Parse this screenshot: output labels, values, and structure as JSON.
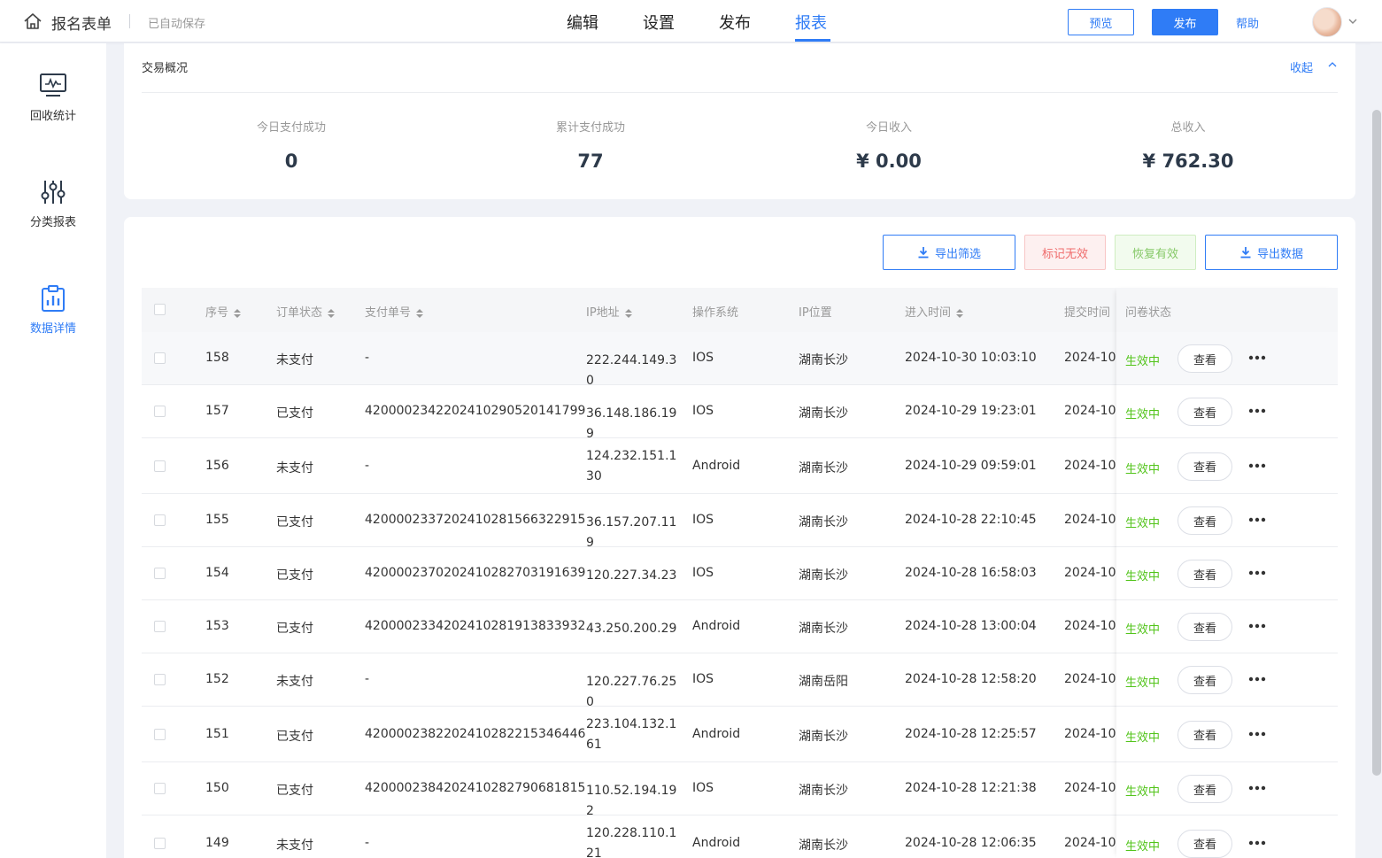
{
  "app": {
    "title": "报名表单",
    "autosave": "已自动保存"
  },
  "nav": {
    "tabs": [
      {
        "label": "编辑"
      },
      {
        "label": "设置"
      },
      {
        "label": "发布"
      },
      {
        "label": "报表",
        "active": true
      }
    ],
    "preview": "预览",
    "publish": "发布",
    "help": "帮助"
  },
  "sidebar": {
    "items": [
      {
        "label": "回收统计",
        "icon": "monitor-chart-icon"
      },
      {
        "label": "分类报表",
        "icon": "sliders-icon"
      },
      {
        "label": "数据详情",
        "icon": "clipboard-chart-icon",
        "active": true
      }
    ]
  },
  "overview": {
    "title": "交易概况",
    "collapse": "收起",
    "stats": [
      {
        "label": "今日支付成功",
        "value": "0"
      },
      {
        "label": "累计支付成功",
        "value": "77"
      },
      {
        "label": "今日收入",
        "value": "¥ 0.00"
      },
      {
        "label": "总收入",
        "value": "¥ 762.30"
      }
    ]
  },
  "actions": {
    "export_filter": "导出筛选",
    "mark_invalid": "标记无效",
    "restore_valid": "恢复有效",
    "export_data": "导出数据"
  },
  "table": {
    "headers": {
      "seq": "序号",
      "order_status": "订单状态",
      "pay_no": "支付单号",
      "ip": "IP地址",
      "os": "操作系统",
      "ip_location": "IP位置",
      "enter_time": "进入时间",
      "submit_time": "提交时间",
      "survey_status": "问卷状态"
    },
    "view_label": "查看",
    "rows": [
      {
        "seq": "158",
        "status": "未支付",
        "pay_no": "-",
        "ip": "222.244.149.30",
        "os": "IOS",
        "loc": "湖南长沙",
        "enter": "2024-10-30 10:03:10",
        "submit": "2024-10-",
        "survey": "生效中"
      },
      {
        "seq": "157",
        "status": "已支付",
        "pay_no": "4200002342202410290520141799",
        "ip": "36.148.186.199",
        "os": "IOS",
        "loc": "湖南长沙",
        "enter": "2024-10-29 19:23:01",
        "submit": "2024-10-",
        "survey": "生效中"
      },
      {
        "seq": "156",
        "status": "未支付",
        "pay_no": "-",
        "ip": "124.232.151.130",
        "os": "Android",
        "loc": "湖南长沙",
        "enter": "2024-10-29 09:59:01",
        "submit": "2024-10-",
        "survey": "生效中"
      },
      {
        "seq": "155",
        "status": "已支付",
        "pay_no": "4200002337202410281566322915",
        "ip": "36.157.207.119",
        "os": "IOS",
        "loc": "湖南长沙",
        "enter": "2024-10-28 22:10:45",
        "submit": "2024-10-",
        "survey": "生效中"
      },
      {
        "seq": "154",
        "status": "已支付",
        "pay_no": "4200002370202410282703191639",
        "ip": "120.227.34.23",
        "os": "IOS",
        "loc": "湖南长沙",
        "enter": "2024-10-28 16:58:03",
        "submit": "2024-10-",
        "survey": "生效中"
      },
      {
        "seq": "153",
        "status": "已支付",
        "pay_no": "4200002334202410281913833932",
        "ip": "43.250.200.29",
        "os": "Android",
        "loc": "湖南长沙",
        "enter": "2024-10-28 13:00:04",
        "submit": "2024-10-",
        "survey": "生效中"
      },
      {
        "seq": "152",
        "status": "未支付",
        "pay_no": "-",
        "ip": "120.227.76.250",
        "os": "IOS",
        "loc": "湖南岳阳",
        "enter": "2024-10-28 12:58:20",
        "submit": "2024-10-",
        "survey": "生效中"
      },
      {
        "seq": "151",
        "status": "已支付",
        "pay_no": "4200002382202410282215346446",
        "ip": "223.104.132.161",
        "os": "Android",
        "loc": "湖南长沙",
        "enter": "2024-10-28 12:25:57",
        "submit": "2024-10-",
        "survey": "生效中"
      },
      {
        "seq": "150",
        "status": "已支付",
        "pay_no": "4200002384202410282790681815",
        "ip": "110.52.194.192",
        "os": "IOS",
        "loc": "湖南长沙",
        "enter": "2024-10-28 12:21:38",
        "submit": "2024-10-",
        "survey": "生效中"
      },
      {
        "seq": "149",
        "status": "未支付",
        "pay_no": "-",
        "ip": "120.228.110.121",
        "os": "Android",
        "loc": "湖南长沙",
        "enter": "2024-10-28 12:06:35",
        "submit": "2024-10-",
        "survey": "生效中"
      }
    ]
  },
  "colors": {
    "accent": "#2f7cf6",
    "success": "#52c41a",
    "danger": "#ef6b6b",
    "page_bg": "#f0f2f7"
  }
}
